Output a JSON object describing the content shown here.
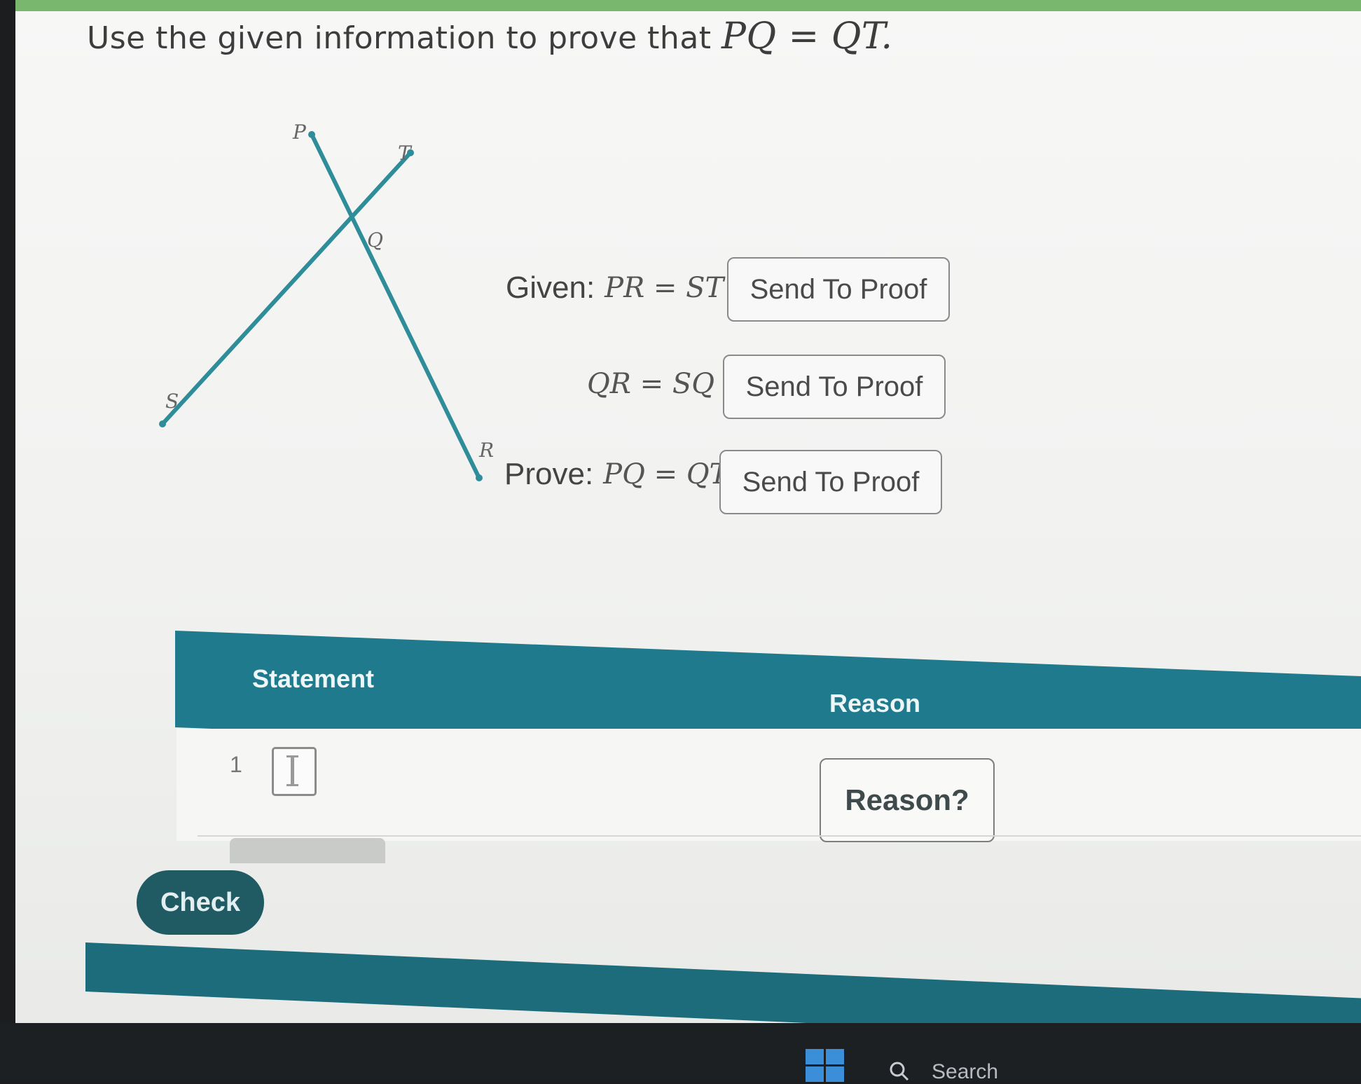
{
  "question": {
    "prefix": "Use the given information to prove that",
    "math": "PQ = QT."
  },
  "diagram": {
    "points": [
      "P",
      "T",
      "Q",
      "S",
      "R"
    ],
    "line_color": "#2f8d9a"
  },
  "given": [
    {
      "label": "Given:",
      "math": "PR = ST",
      "button": "Send To Proof"
    },
    {
      "label": "",
      "math": "QR = SQ",
      "button": "Send To Proof"
    }
  ],
  "prove": {
    "label": "Prove:",
    "math": "PQ = QT",
    "button": "Send To Proof"
  },
  "table": {
    "statement_header": "Statement",
    "reason_header": "Reason",
    "rows": [
      {
        "number": "1",
        "statement": "",
        "reason_button": "Reason?"
      }
    ],
    "header_color": "#1e7a8c"
  },
  "check_button": "Check",
  "taskbar": {
    "search_text": "Search"
  }
}
